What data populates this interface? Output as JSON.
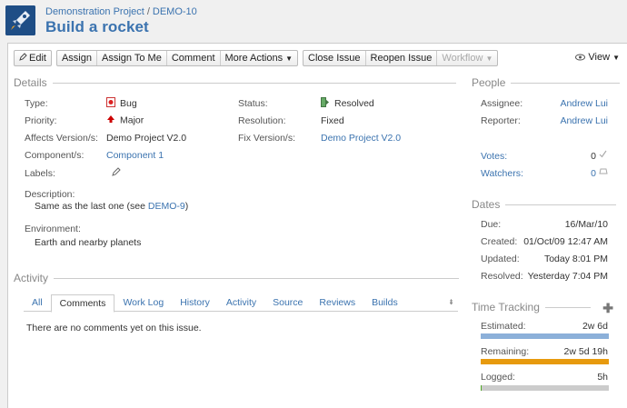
{
  "header": {
    "project": "Demonstration Project",
    "separator": "/",
    "issue_key": "DEMO-10",
    "title": "Build a rocket"
  },
  "toolbar": {
    "edit": "Edit",
    "assign": "Assign",
    "assign_to_me": "Assign To Me",
    "comment": "Comment",
    "more_actions": "More Actions",
    "close_issue": "Close Issue",
    "reopen_issue": "Reopen Issue",
    "workflow": "Workflow",
    "view": "View"
  },
  "details": {
    "title": "Details",
    "type_label": "Type:",
    "type_value": "Bug",
    "priority_label": "Priority:",
    "priority_value": "Major",
    "affects_label": "Affects Version/s:",
    "affects_value": "Demo Project V2.0",
    "component_label": "Component/s:",
    "component_value": "Component 1",
    "labels_label": "Labels:",
    "status_label": "Status:",
    "status_value": "Resolved",
    "resolution_label": "Resolution:",
    "resolution_value": "Fixed",
    "fix_label": "Fix Version/s:",
    "fix_value": "Demo Project V2.0",
    "description_label": "Description:",
    "description_text": "Same as the last one (see ",
    "description_link": "DEMO-9",
    "description_end": ")",
    "environment_label": "Environment:",
    "environment_value": "Earth and nearby planets"
  },
  "activity": {
    "title": "Activity",
    "tabs": [
      "All",
      "Comments",
      "Work Log",
      "History",
      "Activity",
      "Source",
      "Reviews",
      "Builds"
    ],
    "active_tab": "Comments",
    "empty_message": "There are no comments yet on this issue."
  },
  "people": {
    "title": "People",
    "assignee_label": "Assignee:",
    "assignee_value": "Andrew Lui",
    "reporter_label": "Reporter:",
    "reporter_value": "Andrew Lui",
    "votes_label": "Votes:",
    "votes_value": "0",
    "watchers_label": "Watchers:",
    "watchers_value": "0"
  },
  "dates": {
    "title": "Dates",
    "due_label": "Due:",
    "due_value": "16/Mar/10",
    "created_label": "Created:",
    "created_value": "01/Oct/09 12:47 AM",
    "updated_label": "Updated:",
    "updated_value": "Today 8:01 PM",
    "resolved_label": "Resolved:",
    "resolved_value": "Yesterday 7:04 PM"
  },
  "time_tracking": {
    "title": "Time Tracking",
    "estimated_label": "Estimated:",
    "estimated_value": "2w 6d",
    "remaining_label": "Remaining:",
    "remaining_value": "2w 5d 19h",
    "logged_label": "Logged:",
    "logged_value": "5h",
    "estimated_fill": 1.0,
    "remaining_fill": 1.0,
    "logged_fill": 0.01,
    "estimated_color": "#8cb0d9",
    "remaining_color": "#e79a0e",
    "logged_color": "#51a825",
    "empty_color": "#cccccc"
  }
}
